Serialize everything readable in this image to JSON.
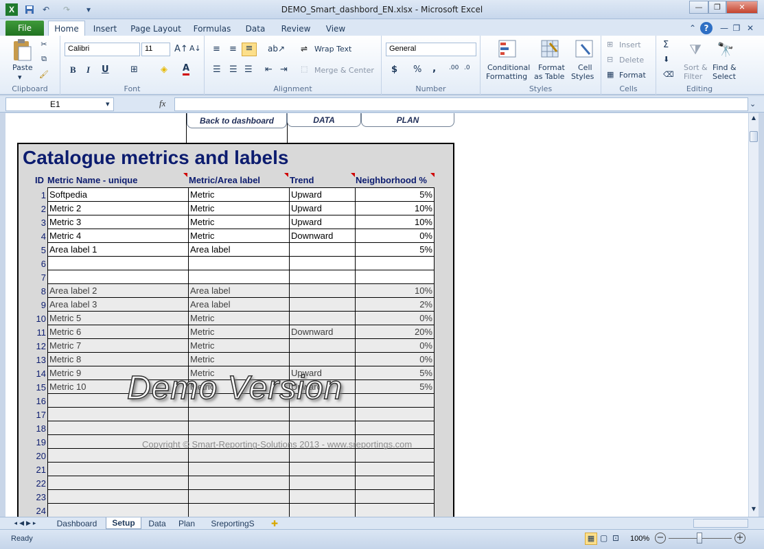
{
  "window": {
    "title": "DEMO_Smart_dashbord_EN.xlsx  -  Microsoft Excel",
    "minimize": "—",
    "restore": "❐",
    "close": "✕"
  },
  "ribbon_tabs": [
    "File",
    "Home",
    "Insert",
    "Page Layout",
    "Formulas",
    "Data",
    "Review",
    "View"
  ],
  "ribbon": {
    "clipboard": {
      "label": "Clipboard",
      "paste": "Paste"
    },
    "font": {
      "label": "Font",
      "font_name": "Calibri",
      "font_size": "11",
      "bold": "B",
      "italic": "I",
      "underline": "U"
    },
    "alignment": {
      "label": "Alignment",
      "wrap_text": "Wrap Text",
      "merge_center": "Merge & Center"
    },
    "number": {
      "label": "Number",
      "format": "General",
      "currency": "$",
      "percent": "%",
      "comma": ","
    },
    "styles": {
      "label": "Styles",
      "conditional": "Conditional",
      "formatting": "Formatting",
      "format": "Format",
      "as_table": "as Table",
      "cell": "Cell",
      "cell_styles": "Styles"
    },
    "cells": {
      "label": "Cells",
      "insert": "Insert",
      "delete": "Delete",
      "format": "Format"
    },
    "editing": {
      "label": "Editing",
      "sort": "Sort &",
      "filter": "Filter",
      "find": "Find &",
      "select": "Select"
    }
  },
  "formula_bar": {
    "name_box": "E1",
    "fx": "fx",
    "value": ""
  },
  "sheet": {
    "nav_buttons": [
      "Back to dashboard",
      "DATA",
      "PLAN"
    ],
    "title": "Catalogue metrics and labels",
    "headers": {
      "id": "ID",
      "name": "Metric Name - unique",
      "label": "Metric/Area label",
      "trend": "Trend",
      "neighborhood": "Neighborhood %"
    },
    "rows": [
      {
        "id": "1",
        "name": "Softpedia",
        "label": "Metric",
        "trend": "Upward",
        "pct": "5%"
      },
      {
        "id": "2",
        "name": "Metric 2",
        "label": "Metric",
        "trend": "Upward",
        "pct": "10%"
      },
      {
        "id": "3",
        "name": "Metric 3",
        "label": "Metric",
        "trend": "Upward",
        "pct": "10%"
      },
      {
        "id": "4",
        "name": "Metric 4",
        "label": "Metric",
        "trend": "Downward",
        "pct": "0%"
      },
      {
        "id": "5",
        "name": "Area label 1",
        "label": "Area label",
        "trend": "",
        "pct": "5%"
      },
      {
        "id": "6",
        "name": "",
        "label": "",
        "trend": "",
        "pct": ""
      },
      {
        "id": "7",
        "name": "",
        "label": "",
        "trend": "",
        "pct": ""
      },
      {
        "id": "8",
        "name": "Area label 2",
        "label": "Area label",
        "trend": "",
        "pct": "10%"
      },
      {
        "id": "9",
        "name": "Area label 3",
        "label": "Area label",
        "trend": "",
        "pct": "2%"
      },
      {
        "id": "10",
        "name": "Metric 5",
        "label": "Metric",
        "trend": "",
        "pct": "0%"
      },
      {
        "id": "11",
        "name": "Metric 6",
        "label": "Metric",
        "trend": "Downward",
        "pct": "20%"
      },
      {
        "id": "12",
        "name": "Metric 7",
        "label": "Metric",
        "trend": "",
        "pct": "0%"
      },
      {
        "id": "13",
        "name": "Metric 8",
        "label": "Metric",
        "trend": "",
        "pct": "0%"
      },
      {
        "id": "14",
        "name": "Metric 9",
        "label": "Metric",
        "trend": "Upward",
        "pct": "5%"
      },
      {
        "id": "15",
        "name": "Metric 10",
        "label": "Metric",
        "trend": "Upward",
        "pct": "5%"
      },
      {
        "id": "16",
        "name": "",
        "label": "",
        "trend": "",
        "pct": ""
      },
      {
        "id": "17",
        "name": "",
        "label": "",
        "trend": "",
        "pct": ""
      },
      {
        "id": "18",
        "name": "",
        "label": "",
        "trend": "",
        "pct": ""
      },
      {
        "id": "19",
        "name": "",
        "label": "",
        "trend": "",
        "pct": ""
      },
      {
        "id": "20",
        "name": "",
        "label": "",
        "trend": "",
        "pct": ""
      },
      {
        "id": "21",
        "name": "",
        "label": "",
        "trend": "",
        "pct": ""
      },
      {
        "id": "22",
        "name": "",
        "label": "",
        "trend": "",
        "pct": ""
      },
      {
        "id": "23",
        "name": "",
        "label": "",
        "trend": "",
        "pct": ""
      },
      {
        "id": "24",
        "name": "",
        "label": "",
        "trend": "",
        "pct": ""
      }
    ],
    "copyright": "Copyright © Smart-Reporting-Solutions 2013 - www.sreportings.com",
    "watermark": "Demo Version"
  },
  "sheet_tabs": [
    "Dashboard",
    "Setup",
    "Data",
    "Plan",
    "SreportingS"
  ],
  "active_sheet": "Setup",
  "status": {
    "ready": "Ready",
    "zoom": "100%"
  }
}
